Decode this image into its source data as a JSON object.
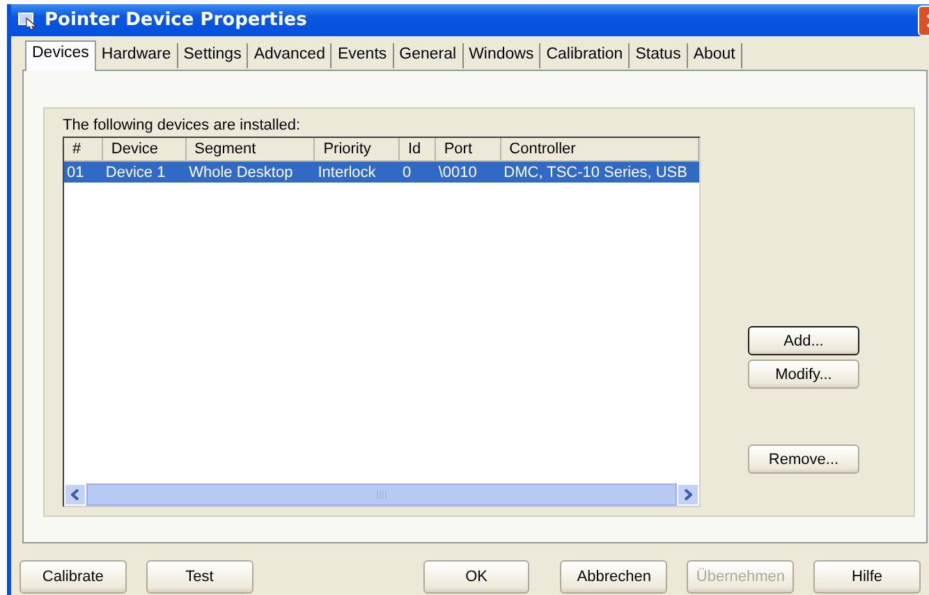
{
  "window": {
    "title": "Pointer Device Properties"
  },
  "tabs": [
    {
      "label": "Devices",
      "selected": true
    },
    {
      "label": "Hardware",
      "selected": false
    },
    {
      "label": "Settings",
      "selected": false
    },
    {
      "label": "Advanced",
      "selected": false
    },
    {
      "label": "Events",
      "selected": false
    },
    {
      "label": "General",
      "selected": false
    },
    {
      "label": "Windows",
      "selected": false
    },
    {
      "label": "Calibration",
      "selected": false
    },
    {
      "label": "Status",
      "selected": false
    },
    {
      "label": "About",
      "selected": false
    }
  ],
  "devices": {
    "label": "The following devices are installed:",
    "columns": [
      "#",
      "Device",
      "Segment",
      "Priority",
      "Id",
      "Port",
      "Controller"
    ],
    "rows": [
      {
        "cells": [
          "01",
          "Device 1",
          "Whole Desktop",
          "Interlock",
          "0",
          "\\0010",
          "DMC, TSC-10 Series, USB"
        ],
        "selected": true
      }
    ]
  },
  "side_buttons": [
    {
      "label": "Add...",
      "default": true
    },
    {
      "label": "Modify...",
      "default": false
    },
    {
      "label": "Remove...",
      "default": false
    }
  ],
  "bottom_buttons": [
    {
      "label": "Calibrate",
      "disabled": false
    },
    {
      "label": "Test",
      "disabled": false
    },
    {
      "label": "OK",
      "disabled": false
    },
    {
      "label": "Abbrechen",
      "disabled": false
    },
    {
      "label": "Übernehmen",
      "disabled": true
    },
    {
      "label": "Hilfe",
      "disabled": false
    }
  ]
}
